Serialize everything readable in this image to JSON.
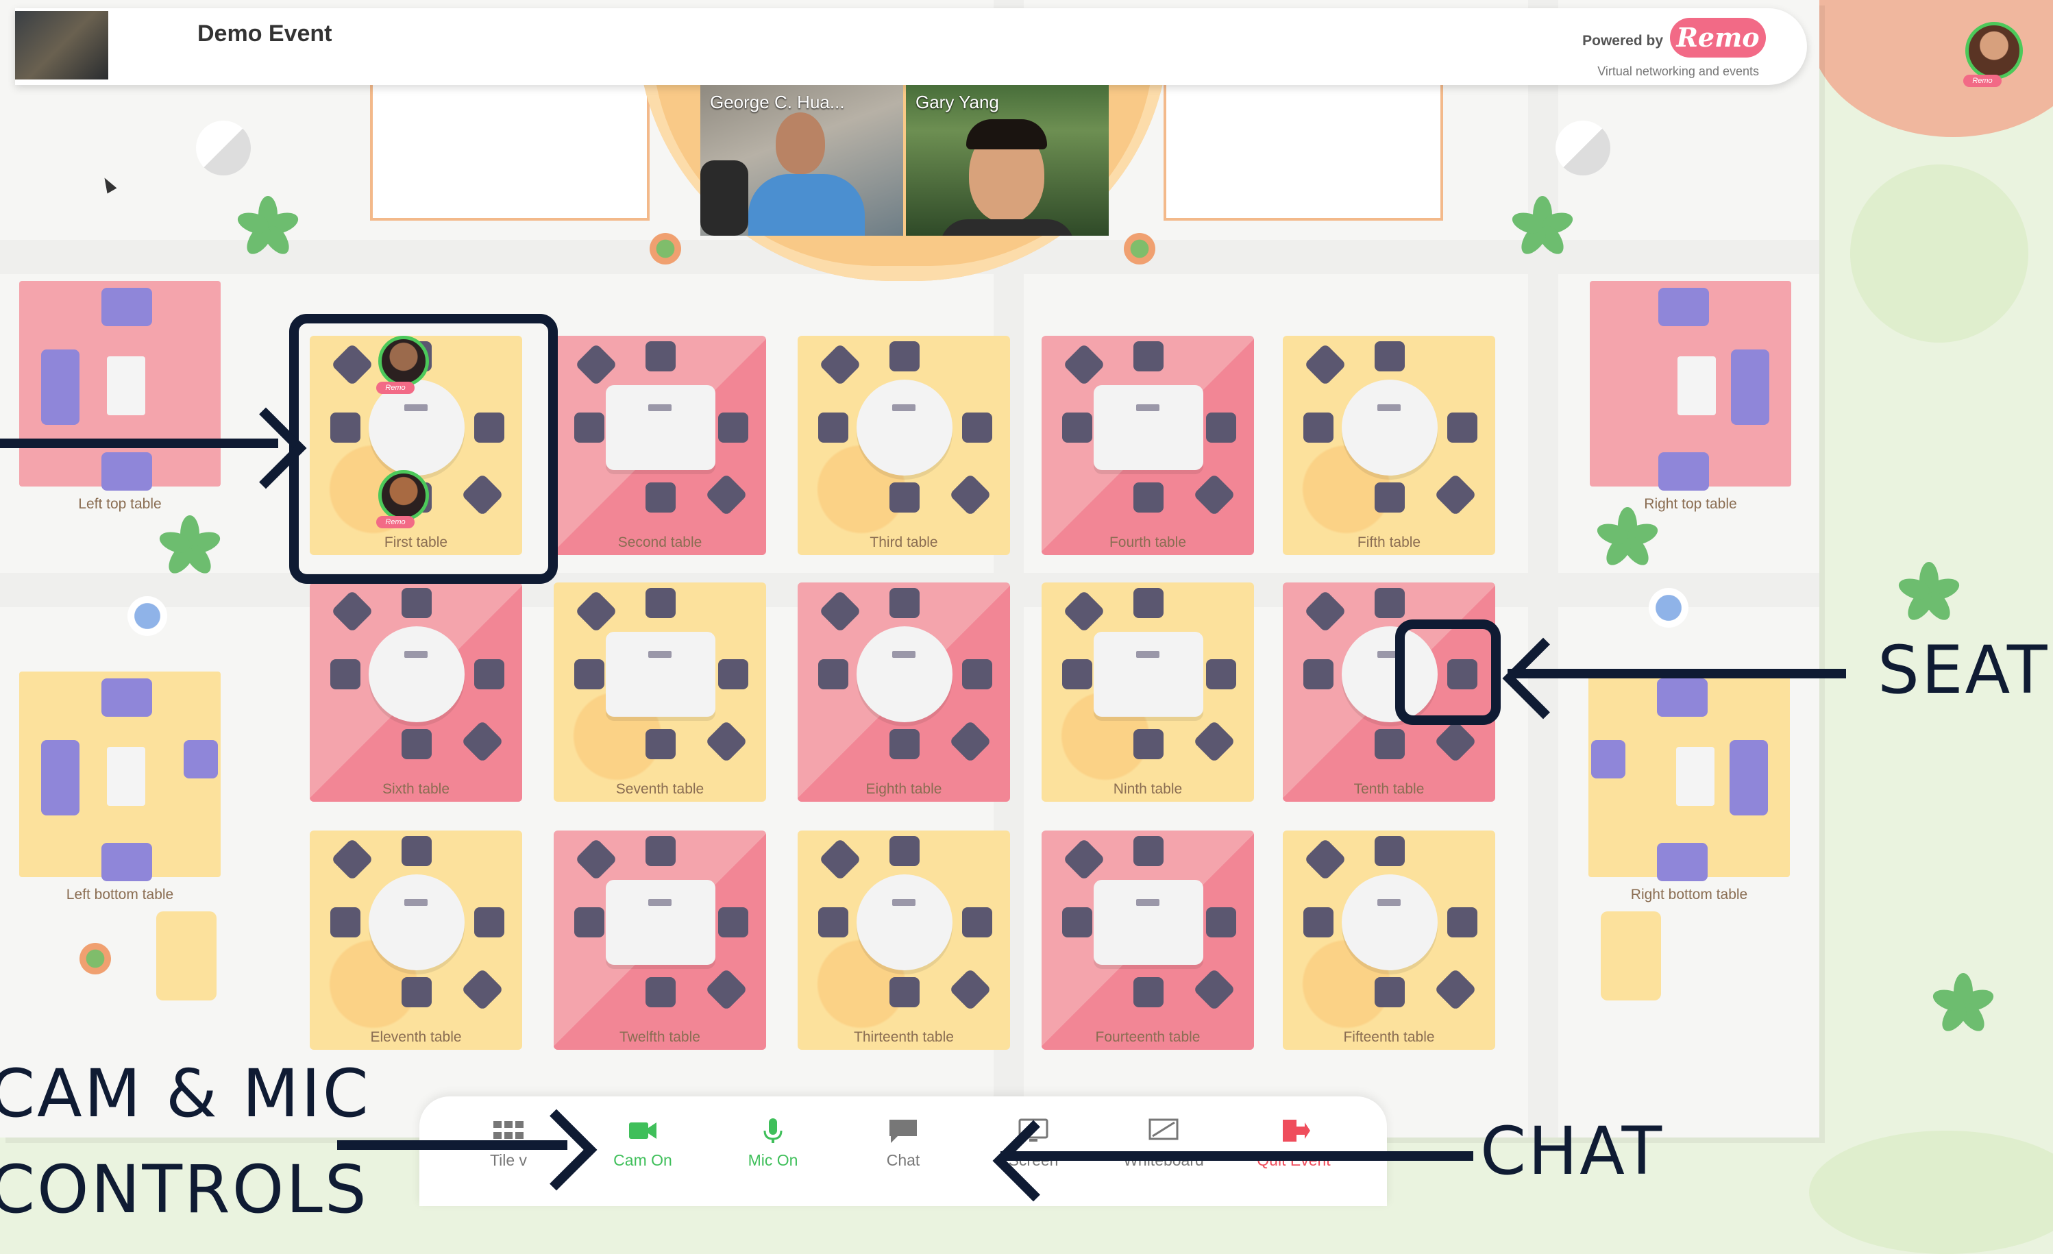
{
  "header": {
    "event_title": "Demo Event",
    "powered_by": "Powered by",
    "brand": "Remo",
    "tagline": "Virtual networking and events"
  },
  "stage": {
    "speakers": [
      {
        "name": "George C. Hua..."
      },
      {
        "name": "Gary Yang"
      }
    ]
  },
  "lounges": {
    "left_top": "Left top table",
    "right_top": "Right top table",
    "left_bottom": "Left bottom table",
    "right_bottom": "Right bottom table"
  },
  "tables": [
    {
      "label": "First table",
      "color": "yellow",
      "shape": "round"
    },
    {
      "label": "Second table",
      "color": "red",
      "shape": "rect"
    },
    {
      "label": "Third table",
      "color": "yellow",
      "shape": "round"
    },
    {
      "label": "Fourth table",
      "color": "red",
      "shape": "rect"
    },
    {
      "label": "Fifth table",
      "color": "yellow",
      "shape": "round"
    },
    {
      "label": "Sixth table",
      "color": "red",
      "shape": "round"
    },
    {
      "label": "Seventh table",
      "color": "yellow",
      "shape": "rect"
    },
    {
      "label": "Eighth table",
      "color": "red",
      "shape": "round"
    },
    {
      "label": "Ninth table",
      "color": "yellow",
      "shape": "rect"
    },
    {
      "label": "Tenth table",
      "color": "red",
      "shape": "round"
    },
    {
      "label": "Eleventh table",
      "color": "yellow",
      "shape": "round"
    },
    {
      "label": "Twelfth table",
      "color": "red",
      "shape": "rect"
    },
    {
      "label": "Thirteenth table",
      "color": "yellow",
      "shape": "round"
    },
    {
      "label": "Fourteenth table",
      "color": "red",
      "shape": "rect"
    },
    {
      "label": "Fifteenth table",
      "color": "yellow",
      "shape": "round"
    }
  ],
  "toolbar": {
    "tile_view": "Tile v",
    "cam": "Cam On",
    "mic": "Mic On",
    "chat": "Chat",
    "share_screen": "Screen",
    "whiteboard": "Whiteboard",
    "quit": "Quit Event"
  },
  "annotations": {
    "seat": "SEAT",
    "cam_mic_line1": "CAM & MIC",
    "cam_mic_line2": "CONTROLS",
    "chat": "CHAT"
  },
  "colors": {
    "accent": "#f26a86",
    "annotation": "#0f1b33",
    "cam_mic_green": "#3fbf5a",
    "quit_red": "#ef4d5c"
  }
}
